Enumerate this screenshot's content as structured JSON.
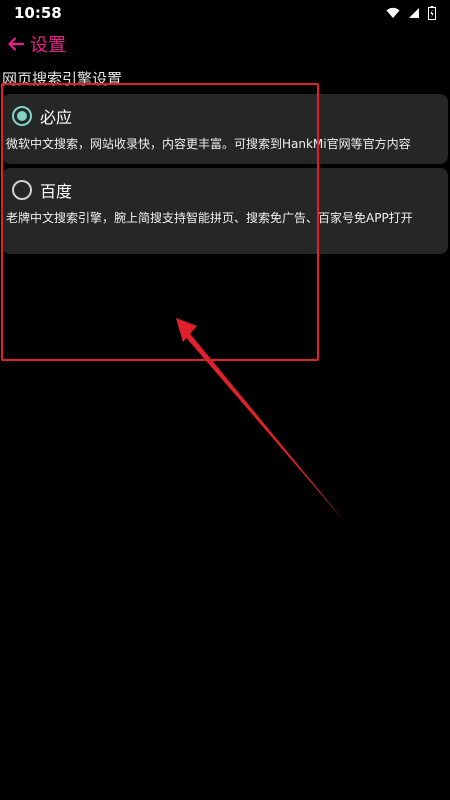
{
  "status_bar": {
    "time": "10:58",
    "icons": [
      "wifi-icon",
      "signal-icon",
      "battery-charging-icon"
    ]
  },
  "app_bar": {
    "back_icon": "arrow-left-icon",
    "title": "设置",
    "accent_color": "#e91e8c"
  },
  "section": {
    "title": "网页搜索引擎设置"
  },
  "options": [
    {
      "name": "必应",
      "selected": true,
      "description": "微软中文搜索，网站收录快，内容更丰富。可搜索到HankMi官网等官方内容"
    },
    {
      "name": "百度",
      "selected": false,
      "description": "老牌中文搜索引擎，腕上简搜支持智能拼页、搜索免广告、百家号免APP打开"
    }
  ],
  "colors": {
    "background": "#000000",
    "card": "#262626",
    "radio_selected": "#7fd3c5",
    "annotation": "#e0212b"
  }
}
